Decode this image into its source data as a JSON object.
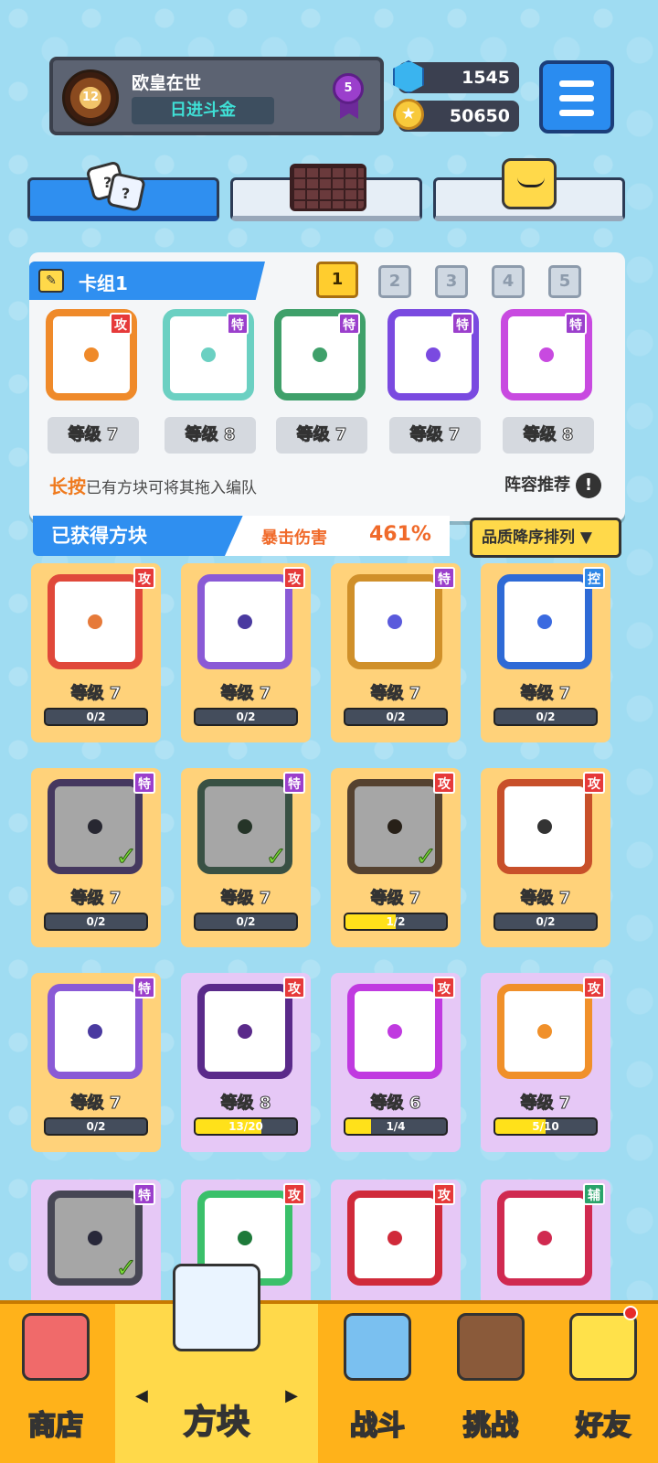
{
  "profile": {
    "player_level": "12",
    "name": "欧皇在世",
    "title": "日进斗金",
    "rank": "5"
  },
  "currency": {
    "gems": "1545",
    "coins": "50650"
  },
  "deck": {
    "title": "卡组1",
    "slots": [
      "1",
      "2",
      "3",
      "4",
      "5"
    ],
    "active_slot": "1",
    "cards": [
      {
        "tag": "攻",
        "level": "等级 7",
        "color": "#ef8a2a"
      },
      {
        "tag": "特",
        "level": "等级 8",
        "color": "#6bd0c2"
      },
      {
        "tag": "特",
        "level": "等级 7",
        "color": "#3fa06a"
      },
      {
        "tag": "特",
        "level": "等级 7",
        "color": "#7a4ae0"
      },
      {
        "tag": "特",
        "level": "等级 8",
        "color": "#c84ae0"
      }
    ],
    "hint_prefix": "长按",
    "hint_text": "已有方块可将其拖入编队",
    "recommend": "阵容推荐"
  },
  "collection": {
    "title": "已获得方块",
    "crit_label": "暴击伤害",
    "crit_value": "461%",
    "sort_label": "品质降序排列",
    "cards": [
      {
        "tag": "攻",
        "tag_type": "atk",
        "level": "等级 7",
        "progress": "0/2",
        "fill": 0,
        "bg": "gold",
        "frame": "#e0483a",
        "dot": "#e67a3a",
        "check": false,
        "dim": false
      },
      {
        "tag": "攻",
        "tag_type": "atk",
        "level": "等级 7",
        "progress": "0/2",
        "fill": 0,
        "bg": "gold",
        "frame": "#8a5ad6",
        "dot": "#4a3aa0",
        "check": false,
        "dim": false
      },
      {
        "tag": "特",
        "tag_type": "spc",
        "level": "等级 7",
        "progress": "0/2",
        "fill": 0,
        "bg": "gold",
        "frame": "#d0902a",
        "dot": "#5a5adc",
        "check": false,
        "dim": false
      },
      {
        "tag": "控",
        "tag_type": "ctl",
        "level": "等级 7",
        "progress": "0/2",
        "fill": 0,
        "bg": "gold",
        "frame": "#2e6ad6",
        "dot": "#3a6ae0",
        "check": false,
        "dim": false
      },
      {
        "tag": "特",
        "tag_type": "spc",
        "level": "等级 7",
        "progress": "0/2",
        "fill": 0,
        "bg": "gold",
        "frame": "#7a4ae0",
        "dot": "#3a3a60",
        "check": true,
        "dim": true
      },
      {
        "tag": "特",
        "tag_type": "spc",
        "level": "等级 7",
        "progress": "0/2",
        "fill": 0,
        "bg": "gold",
        "frame": "#2e8a5a",
        "dot": "#1e5a2a",
        "check": true,
        "dim": true
      },
      {
        "tag": "攻",
        "tag_type": "atk",
        "level": "等级 7",
        "progress": "1/2",
        "fill": 0.5,
        "bg": "gold",
        "frame": "#a8601a",
        "dot": "#4a3010",
        "check": true,
        "dim": true
      },
      {
        "tag": "攻",
        "tag_type": "atk",
        "level": "等级 7",
        "progress": "0/2",
        "fill": 0,
        "bg": "gold",
        "frame": "#c8502a",
        "dot": "#333333",
        "check": false,
        "dim": false
      },
      {
        "tag": "特",
        "tag_type": "spc",
        "level": "等级 7",
        "progress": "0/2",
        "fill": 0,
        "bg": "gold",
        "frame": "#8a5ad6",
        "dot": "#4a3aa0",
        "check": false,
        "dim": false
      },
      {
        "tag": "攻",
        "tag_type": "atk",
        "level": "等级 8",
        "progress": "13/20",
        "fill": 0.65,
        "bg": "purple",
        "frame": "#5a2a8a",
        "dot": "#5a2a8a",
        "check": false,
        "dim": false
      },
      {
        "tag": "攻",
        "tag_type": "atk",
        "level": "等级 6",
        "progress": "1/4",
        "fill": 0.25,
        "bg": "purple",
        "frame": "#c03ae0",
        "dot": "#c03ae0",
        "check": false,
        "dim": false
      },
      {
        "tag": "攻",
        "tag_type": "atk",
        "level": "等级 7",
        "progress": "5/10",
        "fill": 0.5,
        "bg": "purple",
        "frame": "#f0902a",
        "dot": "#f0902a",
        "check": false,
        "dim": false
      },
      {
        "tag": "特",
        "tag_type": "spc",
        "level": "",
        "progress": "",
        "fill": 0,
        "bg": "purple",
        "frame": "#6a6aa0",
        "dot": "#3a3a80",
        "check": true,
        "dim": true
      },
      {
        "tag": "攻",
        "tag_type": "atk",
        "level": "",
        "progress": "",
        "fill": 0,
        "bg": "purple",
        "frame": "#3ac06a",
        "dot": "#1e7a3a",
        "check": false,
        "dim": false
      },
      {
        "tag": "攻",
        "tag_type": "atk",
        "level": "",
        "progress": "",
        "fill": 0,
        "bg": "purple",
        "frame": "#d02a3a",
        "dot": "#d02a3a",
        "check": false,
        "dim": false
      },
      {
        "tag": "辅",
        "tag_type": "sup",
        "level": "",
        "progress": "",
        "fill": 0,
        "bg": "purple",
        "frame": "#d02a50",
        "dot": "#d02a50",
        "check": false,
        "dim": false
      }
    ]
  },
  "nav": {
    "shop": "商店",
    "blocks": "方块",
    "battle": "战斗",
    "challenge": "挑战",
    "friends": "好友"
  }
}
